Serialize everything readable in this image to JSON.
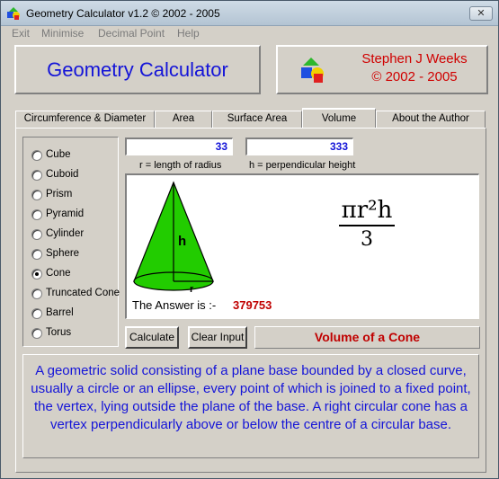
{
  "window": {
    "title": "Geometry Calculator v1.2 ©  2002 - 2005",
    "close_label": "✕"
  },
  "menu": [
    "Exit",
    "Minimise",
    "Decimal Point",
    "Help"
  ],
  "header": {
    "title": "Geometry Calculator",
    "author": "Stephen J Weeks",
    "copyright": "© 2002 - 2005"
  },
  "tabs": [
    "Circumference & Diameter",
    "Area",
    "Surface Area",
    "Volume",
    "About the Author"
  ],
  "active_tab": "Volume",
  "shapes": [
    "Cube",
    "Cuboid",
    "Prism",
    "Pyramid",
    "Cylinder",
    "Sphere",
    "Cone",
    "Truncated Cone",
    "Barrel",
    "Torus"
  ],
  "selected_shape": "Cone",
  "inputs": {
    "radius_value": "33",
    "height_value": "333"
  },
  "hints": {
    "radius": "r = length of radius",
    "height": "h = perpendicular height"
  },
  "diagram": {
    "h_label": "h",
    "r_label": "r",
    "formula_numerator": "πr²h",
    "formula_denominator": "3"
  },
  "result": {
    "label": "The Answer is :-",
    "value": "379753"
  },
  "buttons": {
    "calculate": "Calculate",
    "clear": "Clear Input"
  },
  "shape_title": "Volume of a Cone",
  "description": "A geometric solid consisting of a plane base bounded by a closed curve, usually a circle or an ellipse, every point of which is joined to a fixed point, the vertex, lying outside the plane of the base. A right circular cone has a vertex perpendicularly above or below the centre of a circular base.",
  "colors": {
    "accent_blue": "#1414d8",
    "accent_red": "#c00000",
    "cone_green": "#22cc00",
    "face": "#d4d0c8"
  }
}
